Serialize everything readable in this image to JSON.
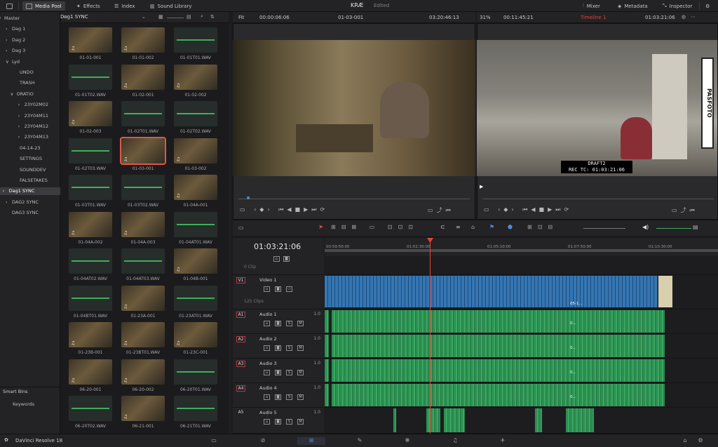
{
  "topbar": {
    "media_pool": "Media Pool",
    "effects": "Effects",
    "index": "Index",
    "sound_library": "Sound Library",
    "project": "KRÆ",
    "status": "Edited",
    "mixer": "Mixer",
    "metadata": "Metadata",
    "inspector": "Inspector"
  },
  "bins": [
    {
      "label": "Master",
      "indent": 0,
      "arrow": "∨"
    },
    {
      "label": "Dag 1",
      "indent": 1,
      "arrow": "›"
    },
    {
      "label": "Dag 2",
      "indent": 1,
      "arrow": "›"
    },
    {
      "label": "Dag 3",
      "indent": 1,
      "arrow": "›"
    },
    {
      "label": "Lyd",
      "indent": 1,
      "arrow": "∨"
    },
    {
      "label": "UNDO",
      "indent": 2,
      "arrow": ""
    },
    {
      "label": "TRASH",
      "indent": 2,
      "arrow": ""
    },
    {
      "label": "ORATIO",
      "indent": 1.6,
      "arrow": "∨"
    },
    {
      "label": "23Y02M02",
      "indent": 2.6,
      "arrow": "›"
    },
    {
      "label": "23Y04M11",
      "indent": 2.6,
      "arrow": "›"
    },
    {
      "label": "23Y04M12",
      "indent": 2.6,
      "arrow": "›"
    },
    {
      "label": "23Y04M13",
      "indent": 2.6,
      "arrow": "›"
    },
    {
      "label": "04-14-23",
      "indent": 2,
      "arrow": ""
    },
    {
      "label": "SETTINGS",
      "indent": 2,
      "arrow": ""
    },
    {
      "label": "SOUNDDEV",
      "indent": 2,
      "arrow": ""
    },
    {
      "label": "FALSETAKES",
      "indent": 2,
      "arrow": ""
    },
    {
      "label": "Dag1 SYNC",
      "indent": 0.6,
      "arrow": "›",
      "selected": true
    },
    {
      "label": "DAG2 SYNC",
      "indent": 1,
      "arrow": "›"
    },
    {
      "label": "DAG3 SYNC",
      "indent": 1,
      "arrow": ""
    }
  ],
  "smart_bins": {
    "title": "Smart Bins",
    "keywords": "Keywords"
  },
  "pool": {
    "bin_name": "Dag1 SYNC"
  },
  "clips": [
    {
      "n": "01-01-001",
      "t": "v"
    },
    {
      "n": "01-01-002",
      "t": "v"
    },
    {
      "n": "01-01T01.WAV",
      "t": "a"
    },
    {
      "n": "01-01T02.WAV",
      "t": "a"
    },
    {
      "n": "01-02-001",
      "t": "v"
    },
    {
      "n": "01-02-002",
      "t": "v"
    },
    {
      "n": "01-02-003",
      "t": "v"
    },
    {
      "n": "01-02T01.WAV",
      "t": "a"
    },
    {
      "n": "01-02T02.WAV",
      "t": "a"
    },
    {
      "n": "01-02T03.WAV",
      "t": "a"
    },
    {
      "n": "01-03-001",
      "t": "v",
      "sel": true
    },
    {
      "n": "01-03-002",
      "t": "v"
    },
    {
      "n": "01-03T01.WAV",
      "t": "a"
    },
    {
      "n": "01-03T02.WAV",
      "t": "a"
    },
    {
      "n": "01-04A-001",
      "t": "v"
    },
    {
      "n": "01-04A-002",
      "t": "v"
    },
    {
      "n": "01-04A-003",
      "t": "v"
    },
    {
      "n": "01-04AT01.WAV",
      "t": "a"
    },
    {
      "n": "01-04AT02.WAV",
      "t": "a"
    },
    {
      "n": "01-04AT03.WAV",
      "t": "a"
    },
    {
      "n": "01-04B-001",
      "t": "v"
    },
    {
      "n": "01-04BT01.WAV",
      "t": "a"
    },
    {
      "n": "01-23A-001",
      "t": "v"
    },
    {
      "n": "01-23AT01.WAV",
      "t": "a"
    },
    {
      "n": "01-23B-001",
      "t": "v"
    },
    {
      "n": "01-23BT01.WAV",
      "t": "v"
    },
    {
      "n": "01-23C-001",
      "t": "v"
    },
    {
      "n": "06-20-001",
      "t": "v"
    },
    {
      "n": "06-20-002",
      "t": "v"
    },
    {
      "n": "06-20T01.WAV",
      "t": "a"
    },
    {
      "n": "06-20T02.WAV",
      "t": "a"
    },
    {
      "n": "06-21-001",
      "t": "v"
    },
    {
      "n": "06-21T01.WAV",
      "t": "a"
    }
  ],
  "source_viewer": {
    "fit": "Fit",
    "duration": "00:00:06:06",
    "clip": "01-03-001",
    "timecode": "03:20:46:13"
  },
  "timeline_viewer": {
    "zoom": "31%",
    "duration": "00:11:45:21",
    "timeline": "Timeline 1",
    "timecode": "01:03:21:06",
    "burn_name": "DRAFT2",
    "burn_tc": "REC TC: 01:03:21:06",
    "sign_text": "PASFOTO"
  },
  "timeline": {
    "current_tc": "01:03:21:06",
    "ticks": [
      "00:59:50:00",
      "01:02:30:00",
      "01:05:10:00",
      "01:07:50:00",
      "01:10:30:00"
    ],
    "tracks": [
      {
        "id": "V1",
        "name": "Video 1",
        "info": "125 Clips"
      },
      {
        "id": "A1",
        "name": "Audio 1",
        "vol": "1.0"
      },
      {
        "id": "A2",
        "name": "Audio 2",
        "vol": "1.0"
      },
      {
        "id": "A3",
        "name": "Audio 3",
        "vol": "1.0"
      },
      {
        "id": "A4",
        "name": "Audio 4",
        "vol": "1.0"
      },
      {
        "id": "A5",
        "name": "Audio 5",
        "vol": "1.0"
      }
    ],
    "top_info": "0 Clip",
    "v_clip_label": "05-1...",
    "a_clip_label": "0..."
  },
  "app_name": "DaVinci Resolve 18",
  "colors": {
    "accent": "#e0453b",
    "video": "#3576b3",
    "audio": "#2f9654"
  }
}
